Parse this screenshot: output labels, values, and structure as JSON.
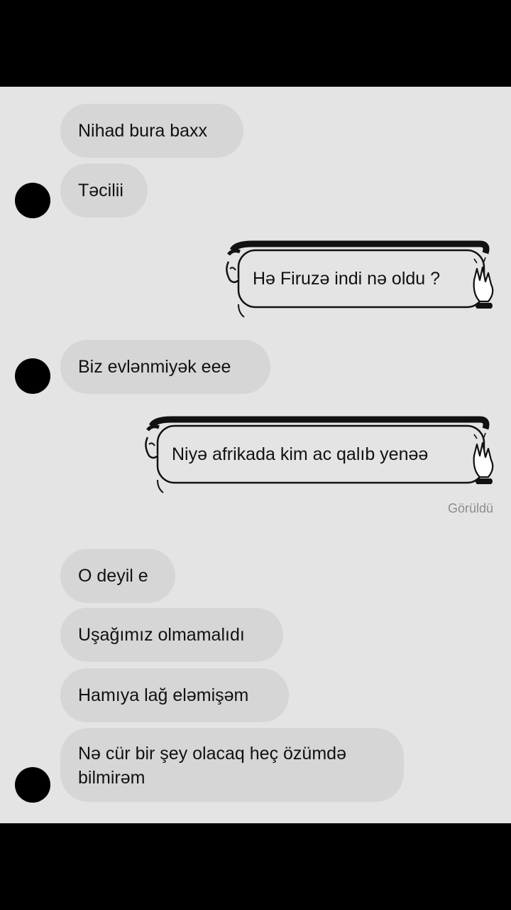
{
  "chat": {
    "received_group1": [
      "Nihad bura baxx",
      "Təcilii"
    ],
    "sent1": "Hə Firuzə indi nə oldu ?",
    "received_group2": [
      "Biz evlənmiyək eee"
    ],
    "sent2": "Niyə afrikada kim ac qalıb yenəə",
    "seen_label": "Görüldü",
    "received_group3": [
      "O deyil e",
      "Uşağımız olmamalıdı",
      "Hamıya lağ eləmişəm",
      "Nə cür bir şey olacaq heç özümdə bilmirəm"
    ]
  },
  "colors": {
    "background": "#e4e4e5",
    "bubble": "#d6d6d7",
    "avatar": "#000000",
    "letterbox": "#000000"
  },
  "icons": [
    "avatar",
    "cartoon-head-icon",
    "waving-hand-icon"
  ]
}
